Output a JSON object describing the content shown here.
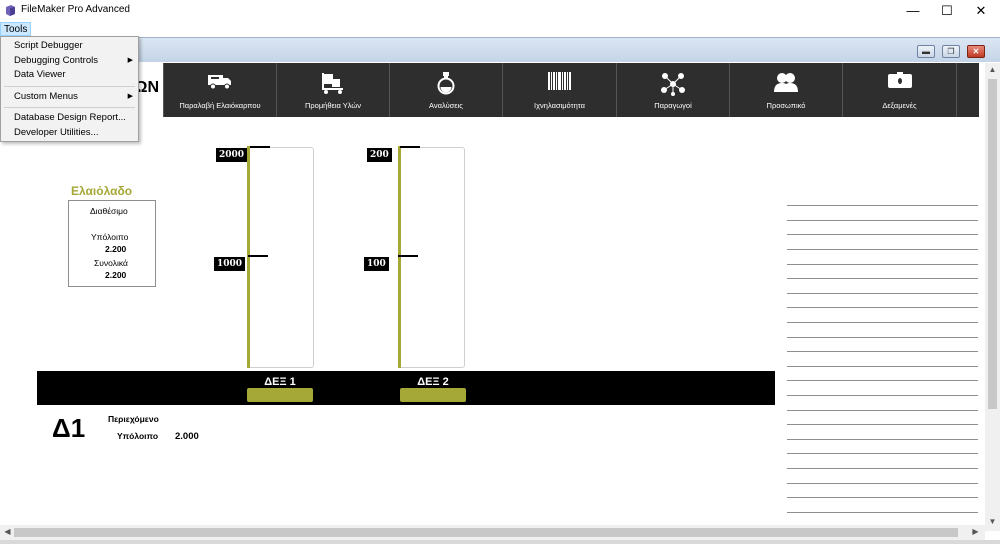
{
  "window": {
    "title": "FileMaker Pro Advanced"
  },
  "menu": {
    "tools_label": "Tools",
    "items": [
      {
        "label": "Script Debugger",
        "submenu": false
      },
      {
        "label": "Debugging Controls",
        "submenu": true
      },
      {
        "label": "Data Viewer",
        "submenu": false
      },
      {
        "label": "Custom Menus",
        "submenu": true
      },
      {
        "label": "Database Design Report...",
        "submenu": false
      },
      {
        "label": "Developer Utilities...",
        "submenu": false
      }
    ]
  },
  "nav": {
    "header_text": "ΩΝ",
    "items": [
      {
        "label": "Παραλαβή Ελαιόκαρπου",
        "icon": "truck-icon"
      },
      {
        "label": "Προμήθεια Υλών",
        "icon": "hand-truck-icon"
      },
      {
        "label": "Αναλύσεις",
        "icon": "flask-icon"
      },
      {
        "label": "Ιχνηλασιμότητα",
        "icon": "barcode-icon"
      },
      {
        "label": "Παραγωγοί",
        "icon": "network-icon"
      },
      {
        "label": "Προσωπικό",
        "icon": "people-icon"
      },
      {
        "label": "Δεξαμενές",
        "icon": "tank-icon"
      }
    ]
  },
  "summary": {
    "title": "Ελαιόλαδο",
    "available_label": "Διαθέσιμο",
    "remaining_label": "Υπόλοιπο",
    "remaining_value": "2.200",
    "total_label": "Συνολικά",
    "total_value": "2.200"
  },
  "tanks": [
    {
      "name": "ΔΕΞ 1",
      "tick_top": "2000",
      "tick_mid": "1000"
    },
    {
      "name": "ΔΕΞ 2",
      "tick_top": "200",
      "tick_mid": "100"
    }
  ],
  "detail": {
    "title": "Δ1",
    "content_label": "Περιεχόμενο",
    "remaining_label": "Υπόλοιπο",
    "remaining_value": "2.000"
  },
  "colors": {
    "accent": "#a5a836",
    "nav_bg": "#2e2e2e",
    "menu_highlight": "#cce8ff"
  }
}
